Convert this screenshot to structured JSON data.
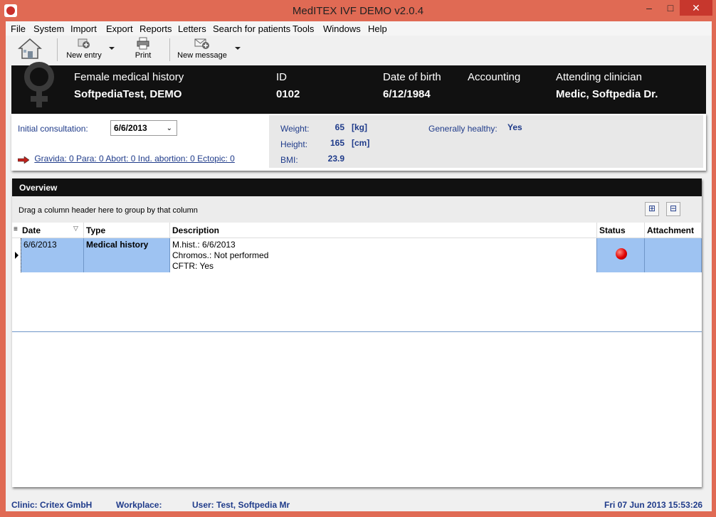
{
  "window": {
    "title": "MedITEX IVF DEMO v2.0.4"
  },
  "menu": [
    "File",
    "System",
    "Import",
    "Export",
    "Reports",
    "Letters",
    "Search for patients",
    "Tools",
    "Windows",
    "Help"
  ],
  "toolbar": {
    "new_entry": "New entry",
    "print": "Print",
    "new_message": "New message"
  },
  "patient_header": {
    "history_label": "Female medical history",
    "name": "SoftpediaTest, DEMO",
    "id_label": "ID",
    "id_value": "0102",
    "dob_label": "Date of birth",
    "dob_value": "6/12/1984",
    "accounting_label": "Accounting",
    "clinician_label": "Attending clinician",
    "clinician_value": "Medic, Softpedia Dr."
  },
  "consultation": {
    "label": "Initial consultation:",
    "value": "6/6/2013",
    "gravida_text": "Gravida: 0  Para: 0  Abort: 0  Ind. abortion: 0  Ectopic: 0"
  },
  "vitals": {
    "weight_label": "Weight:",
    "weight_value": "65",
    "weight_unit": "[kg]",
    "height_label": "Height:",
    "height_value": "165",
    "height_unit": "[cm]",
    "bmi_label": "BMI:",
    "bmi_value": "23.9",
    "healthy_label": "Generally healthy:",
    "healthy_value": "Yes"
  },
  "overview": {
    "title": "Overview",
    "group_hint": "Drag a column header here to group by that column",
    "columns": [
      "Date",
      "Type",
      "Description",
      "Status",
      "Attachment"
    ],
    "rows": [
      {
        "date": "6/6/2013",
        "type": "Medical history",
        "desc_line1": "M.hist.: 6/6/2013",
        "desc_line2": "Chromos.: Not performed",
        "desc_line3": "CFTR: Yes"
      }
    ]
  },
  "statusbar": {
    "clinic": "Clinic: Critex GmbH",
    "workplace": "Workplace:",
    "user": "User: Test, Softpedia Mr",
    "datetime": "Fri 07 Jun 2013 15:53:26"
  }
}
